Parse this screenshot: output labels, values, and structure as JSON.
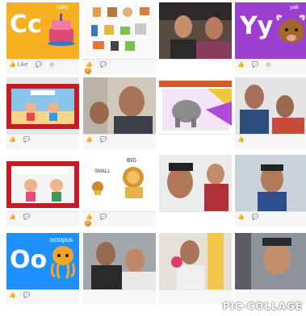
{
  "tiles": [
    {
      "id": "cake",
      "letters": "Cc",
      "word": "cake"
    },
    {
      "id": "worksheet"
    },
    {
      "id": "family-video-1"
    },
    {
      "id": "yak",
      "letters": "Yy",
      "word": "yak"
    },
    {
      "id": "cartoon-beach"
    },
    {
      "id": "man-selfie"
    },
    {
      "id": "elephant-slide"
    },
    {
      "id": "couple-video"
    },
    {
      "id": "cartoon-kids"
    },
    {
      "id": "small-big",
      "small_label": "SMALL",
      "big_label": "BIG"
    },
    {
      "id": "man-and-woman"
    },
    {
      "id": "boy-video"
    },
    {
      "id": "octopus",
      "letters": "Oo",
      "word": "octopus"
    },
    {
      "id": "woman-and-man"
    },
    {
      "id": "girl-with-ball"
    },
    {
      "id": "boy-closeup"
    }
  ],
  "watermark": "PIC·COLLAGE",
  "colors": {
    "cake_bg": "#f6b021",
    "yak_bg": "#9b3fd1",
    "octopus_bg": "#1e90ff",
    "meta_bar": "#f6f6f6"
  }
}
